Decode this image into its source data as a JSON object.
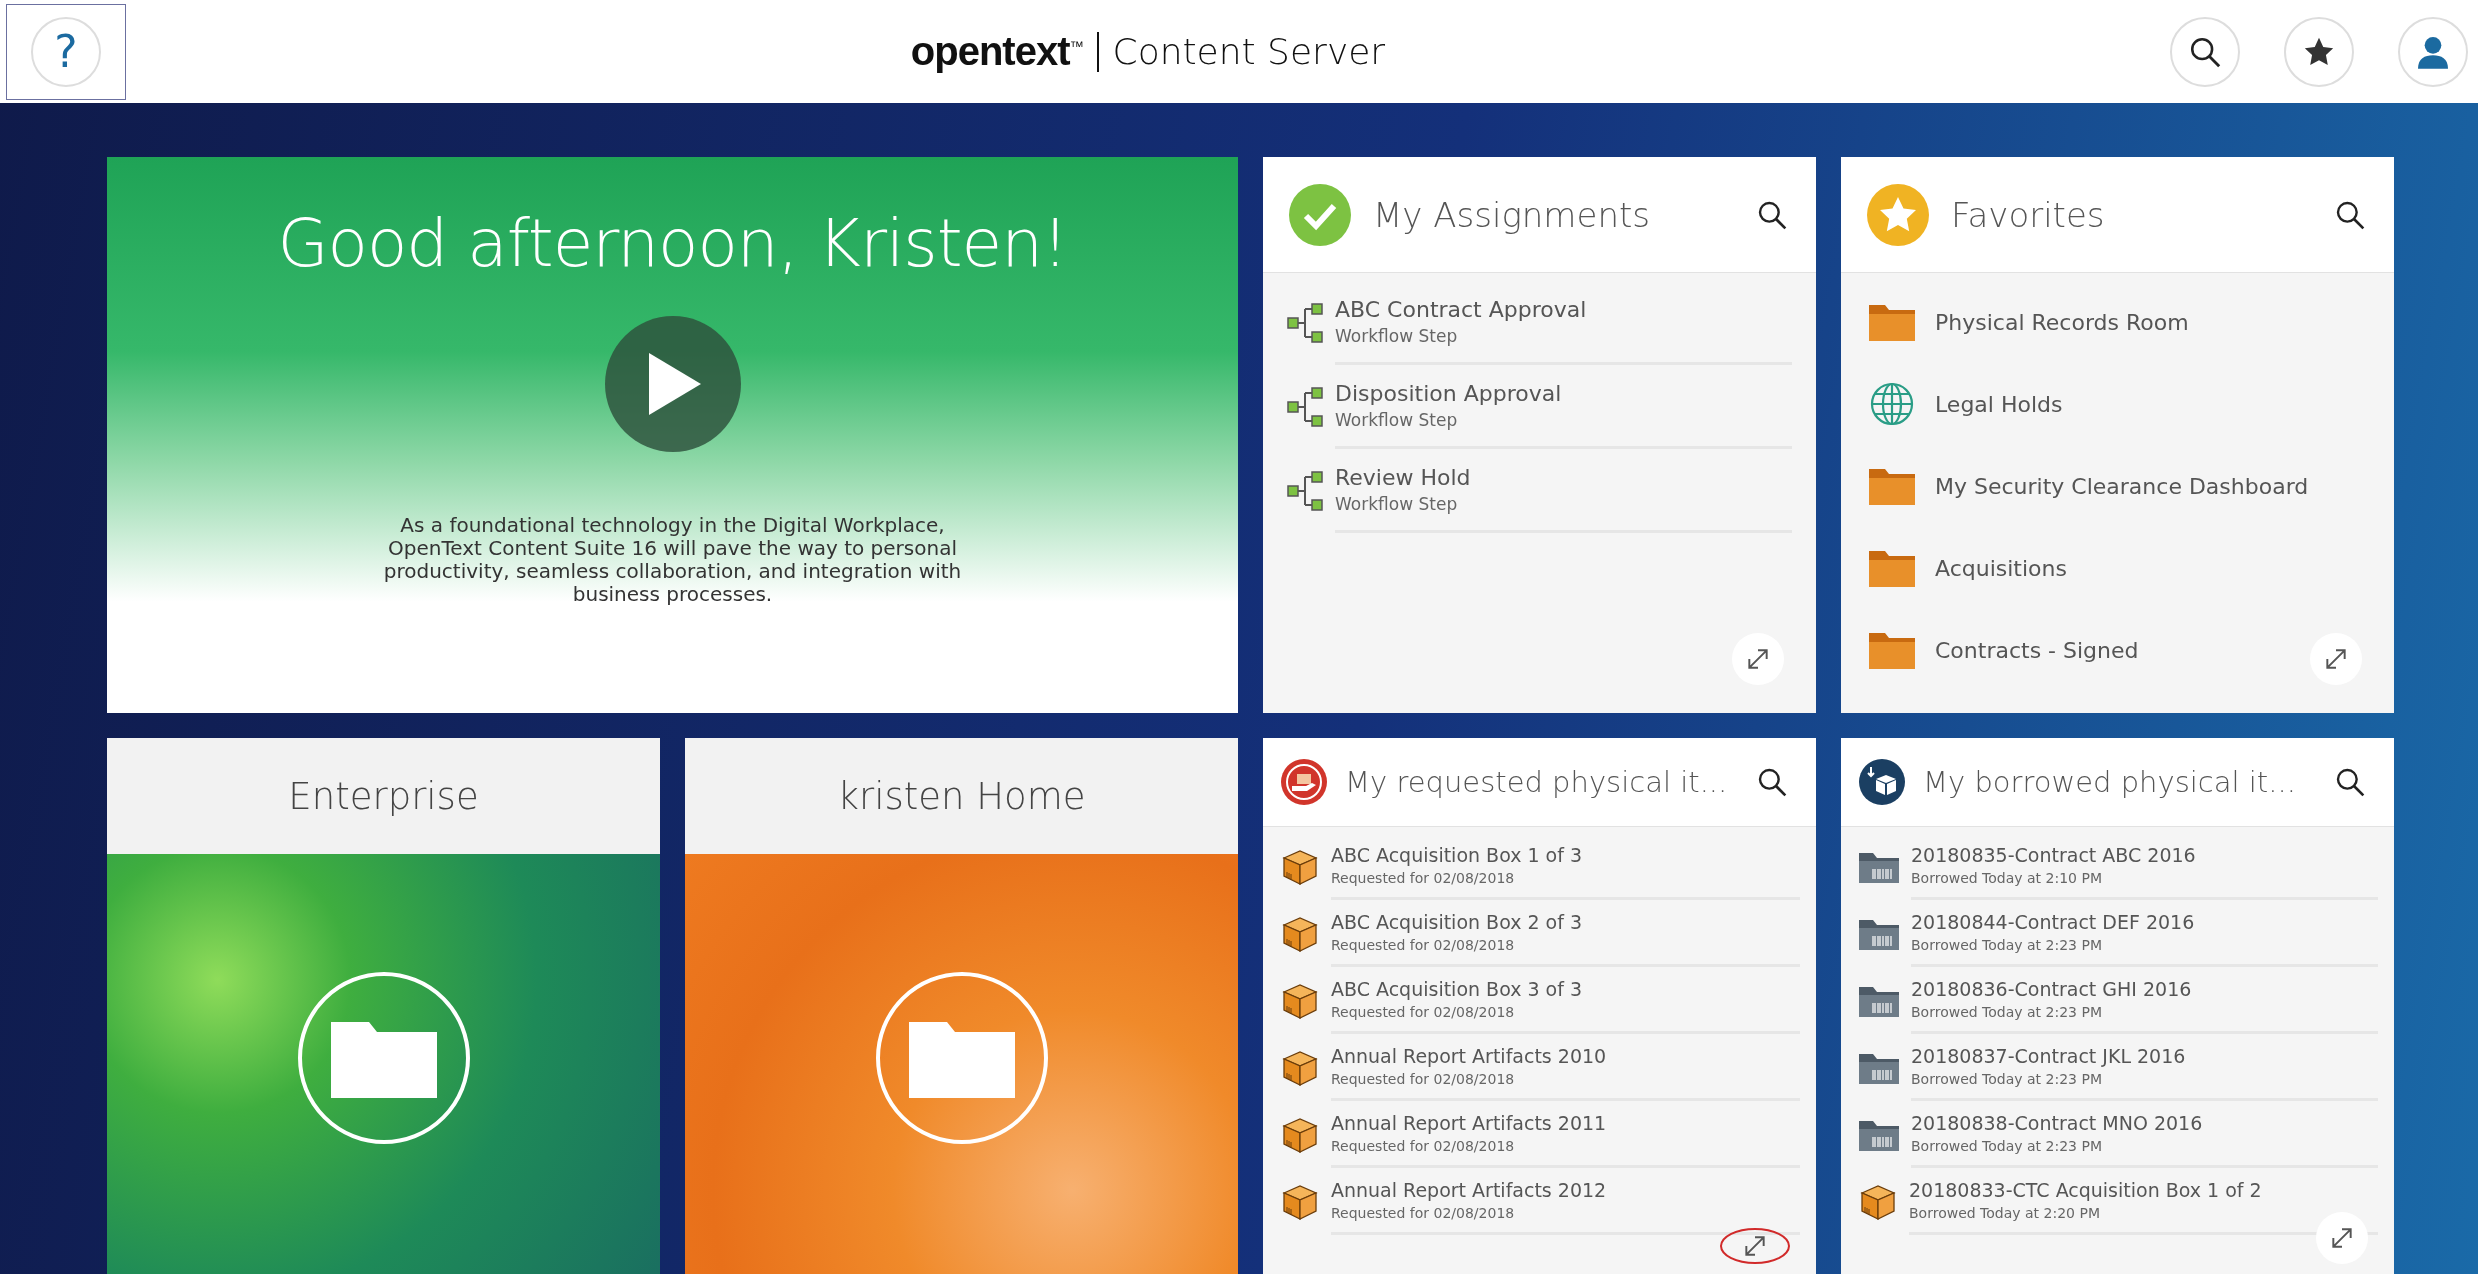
{
  "header": {
    "help": "?",
    "logo": "opentext$^{™}$",
    "product": "Content Server"
  },
  "hero": {
    "greeting": "Good afternoon, Kristen!",
    "text": "As a foundational technology in the Digital Workplace, OpenText Content Suite 16 will pave the way to personal productivity, seamless collaboration, and integration with business processes."
  },
  "tiles": [
    {
      "title": "My Assignments",
      "expand_highlighted": false,
      "items": [
        {
          "kind": "workflow",
          "name": "ABC Contract Approval",
          "detail": "Workflow Step"
        },
        {
          "kind": "workflow",
          "name": "Disposition Approval",
          "detail": "Workflow Step"
        },
        {
          "kind": "workflow",
          "name": "Review Hold",
          "detail": "Workflow Step"
        }
      ]
    },
    {
      "title": "Favorites",
      "expand_highlighted": false,
      "items": [
        {
          "kind": "folder",
          "name": "Physical Records Room"
        },
        {
          "kind": "globe",
          "name": "Legal Holds"
        },
        {
          "kind": "folder",
          "name": "My Security Clearance Dashboard"
        },
        {
          "kind": "folder",
          "name": "Acquisitions"
        },
        {
          "kind": "folder",
          "name": "Contracts - Signed"
        }
      ]
    }
  ],
  "folders": [
    {
      "title": "Enterprise"
    },
    {
      "title": "kristen Home"
    }
  ],
  "small_tiles": [
    {
      "title": "My requested physical it...",
      "expand_highlighted": true,
      "items": [
        {
          "kind": "box",
          "name": "ABC Acquisition Box 1 of 3",
          "detail": "Requested for 02/08/2018"
        },
        {
          "kind": "box",
          "name": "ABC Acquisition Box 2 of 3",
          "detail": "Requested for 02/08/2018"
        },
        {
          "kind": "box",
          "name": "ABC Acquisition Box 3 of 3",
          "detail": "Requested for 02/08/2018"
        },
        {
          "kind": "box",
          "name": "Annual Report Artifacts 2010",
          "detail": "Requested for 02/08/2018"
        },
        {
          "kind": "box",
          "name": "Annual Report Artifacts 2011",
          "detail": "Requested for 02/08/2018"
        },
        {
          "kind": "box",
          "name": "Annual Report Artifacts 2012",
          "detail": "Requested for 02/08/2018"
        }
      ]
    },
    {
      "title": "My borrowed physical it...",
      "expand_highlighted": false,
      "items": [
        {
          "kind": "record",
          "name": "20180835-Contract ABC 2016",
          "detail": "Borrowed Today at 2:10 PM"
        },
        {
          "kind": "record",
          "name": "20180844-Contract DEF 2016",
          "detail": "Borrowed Today at 2:23 PM"
        },
        {
          "kind": "record",
          "name": "20180836-Contract GHI 2016",
          "detail": "Borrowed Today at 2:23 PM"
        },
        {
          "kind": "record",
          "name": "20180837-Contract JKL 2016",
          "detail": "Borrowed Today at 2:23 PM"
        },
        {
          "kind": "record",
          "name": "20180838-Contract MNO 2016",
          "detail": "Borrowed Today at 2:23 PM"
        },
        {
          "kind": "box",
          "name": "20180833-CTC Acquisition Box 1 of 2",
          "detail": "Borrowed Today at 2:20 PM"
        }
      ]
    }
  ]
}
